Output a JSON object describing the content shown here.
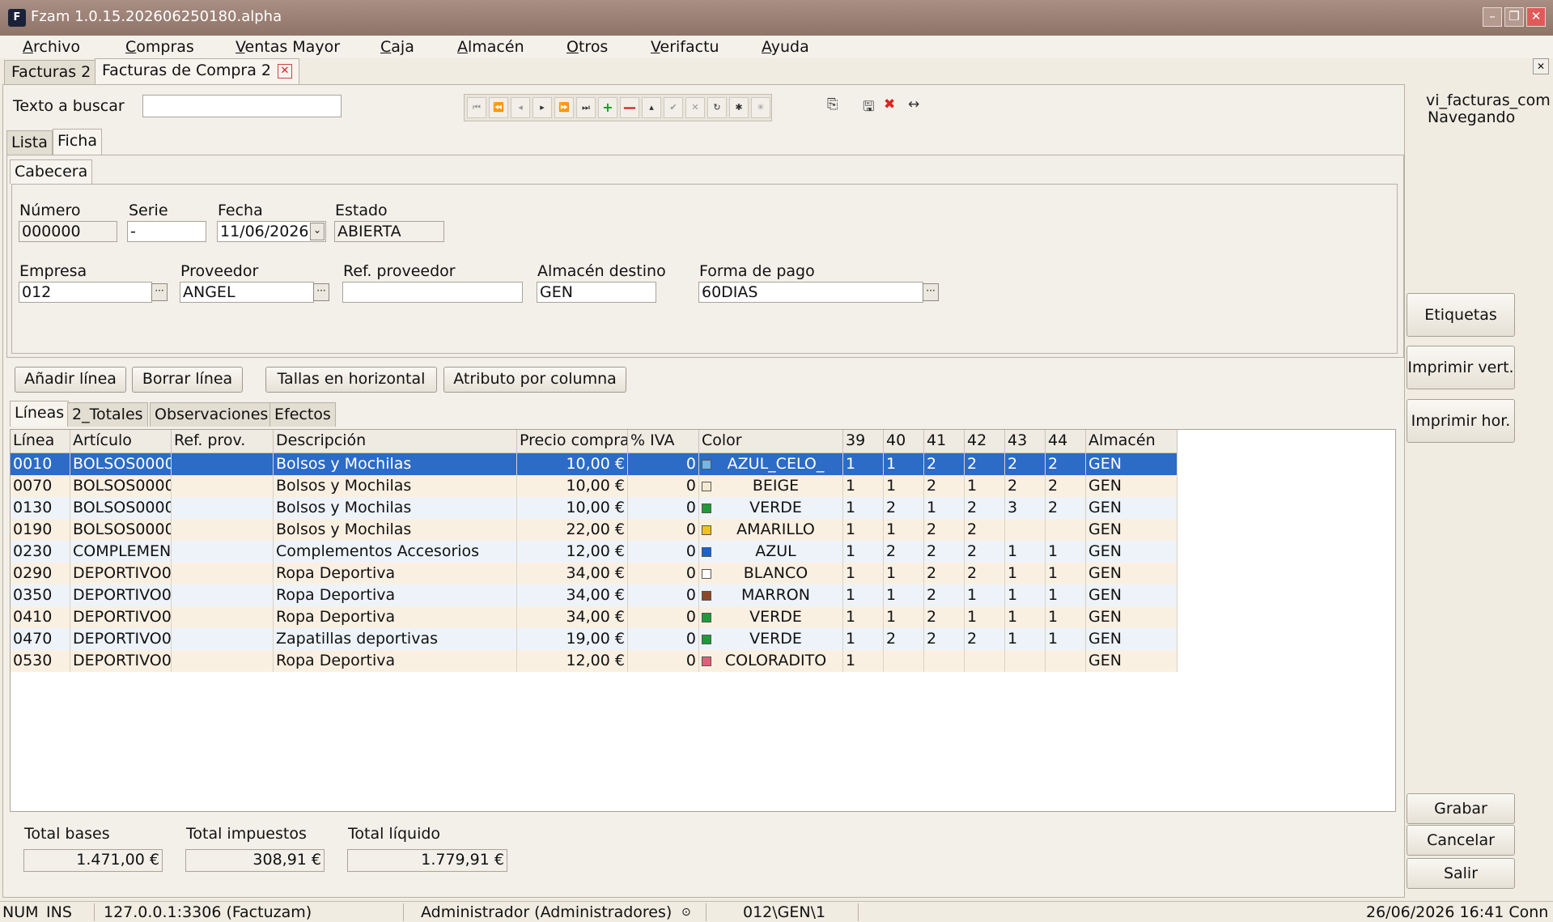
{
  "window": {
    "title": "Fzam 1.0.15.202606250180.alpha",
    "logo": "F"
  },
  "menu": [
    "Archivo",
    "Compras",
    "Ventas Mayor",
    "Caja",
    "Almacén",
    "Otros",
    "Verifactu",
    "Ayuda"
  ],
  "doc_tabs": [
    {
      "label": "Facturas 2"
    },
    {
      "label": "Facturas de Compra 2"
    }
  ],
  "search": {
    "label": "Texto a buscar",
    "value": ""
  },
  "right_info": {
    "view": "vi_facturas_com",
    "mode": "Navegando"
  },
  "view_tabs": [
    "Lista",
    "Ficha"
  ],
  "section_tab": "Cabecera",
  "header": {
    "numero": {
      "label": "Número",
      "value": "000000"
    },
    "serie": {
      "label": "Serie",
      "value": "-"
    },
    "fecha": {
      "label": "Fecha",
      "value": "11/06/2026"
    },
    "estado": {
      "label": "Estado",
      "value": "ABIERTA"
    },
    "empresa": {
      "label": "Empresa",
      "value": "012"
    },
    "proveedor": {
      "label": "Proveedor",
      "value": "ANGEL"
    },
    "ref_proveedor": {
      "label": "Ref. proveedor",
      "value": ""
    },
    "almacen_destino": {
      "label": "Almacén destino",
      "value": "GEN"
    },
    "forma_pago": {
      "label": "Forma de pago",
      "value": "60DIAS"
    }
  },
  "actions": [
    "Añadir línea",
    "Borrar línea",
    "Tallas en horizontal",
    "Atributo por columna"
  ],
  "detail_tabs": [
    "Líneas",
    "2_Totales",
    "Observaciones",
    "Efectos"
  ],
  "columns": [
    "Línea",
    "Artículo",
    "Ref. prov.",
    "Descripción",
    "Precio compra",
    "% IVA",
    "Color",
    "39",
    "40",
    "41",
    "42",
    "43",
    "44",
    "Almacén"
  ],
  "rows": [
    {
      "linea": "0010",
      "articulo": "BOLSOS0000",
      "ref": "",
      "desc": "Bolsos y Mochilas",
      "precio": "10,00 €",
      "iva": "0",
      "color": "AZUL_CELO_",
      "swatch": "#6fb8e8",
      "t39": "1",
      "t40": "1",
      "t41": "2",
      "t42": "2",
      "t43": "2",
      "t44": "2",
      "alm": "GEN"
    },
    {
      "linea": "0070",
      "articulo": "BOLSOS0000",
      "ref": "",
      "desc": "Bolsos y Mochilas",
      "precio": "10,00 €",
      "iva": "0",
      "color": "BEIGE",
      "swatch": "#f3ead0",
      "t39": "1",
      "t40": "1",
      "t41": "2",
      "t42": "1",
      "t43": "2",
      "t44": "2",
      "alm": "GEN"
    },
    {
      "linea": "0130",
      "articulo": "BOLSOS0000",
      "ref": "",
      "desc": "Bolsos y Mochilas",
      "precio": "10,00 €",
      "iva": "0",
      "color": "VERDE",
      "swatch": "#1f9a3a",
      "t39": "1",
      "t40": "2",
      "t41": "1",
      "t42": "2",
      "t43": "3",
      "t44": "2",
      "alm": "GEN"
    },
    {
      "linea": "0190",
      "articulo": "BOLSOS0000",
      "ref": "",
      "desc": "Bolsos y Mochilas",
      "precio": "22,00 €",
      "iva": "0",
      "color": "AMARILLO",
      "swatch": "#f0c21a",
      "t39": "1",
      "t40": "1",
      "t41": "2",
      "t42": "2",
      "t43": "",
      "t44": "",
      "alm": "GEN"
    },
    {
      "linea": "0230",
      "articulo": "COMPLEMEN",
      "ref": "",
      "desc": "Complementos Accesorios",
      "precio": "12,00 €",
      "iva": "0",
      "color": "AZUL",
      "swatch": "#1f5fd0",
      "t39": "1",
      "t40": "2",
      "t41": "2",
      "t42": "2",
      "t43": "1",
      "t44": "1",
      "alm": "GEN"
    },
    {
      "linea": "0290",
      "articulo": "DEPORTIVO0",
      "ref": "",
      "desc": "Ropa Deportiva",
      "precio": "34,00 €",
      "iva": "0",
      "color": "BLANCO",
      "swatch": "#ffffff",
      "t39": "1",
      "t40": "1",
      "t41": "2",
      "t42": "2",
      "t43": "1",
      "t44": "1",
      "alm": "GEN"
    },
    {
      "linea": "0350",
      "articulo": "DEPORTIVO0",
      "ref": "",
      "desc": "Ropa Deportiva",
      "precio": "34,00 €",
      "iva": "0",
      "color": "MARRON",
      "swatch": "#8a4a2a",
      "t39": "1",
      "t40": "1",
      "t41": "2",
      "t42": "1",
      "t43": "1",
      "t44": "1",
      "alm": "GEN"
    },
    {
      "linea": "0410",
      "articulo": "DEPORTIVO0",
      "ref": "",
      "desc": "Ropa Deportiva",
      "precio": "34,00 €",
      "iva": "0",
      "color": "VERDE",
      "swatch": "#1f9a3a",
      "t39": "1",
      "t40": "1",
      "t41": "2",
      "t42": "1",
      "t43": "1",
      "t44": "1",
      "alm": "GEN"
    },
    {
      "linea": "0470",
      "articulo": "DEPORTIVO0",
      "ref": "",
      "desc": "Zapatillas deportivas",
      "precio": "19,00 €",
      "iva": "0",
      "color": "VERDE",
      "swatch": "#1f9a3a",
      "t39": "1",
      "t40": "2",
      "t41": "2",
      "t42": "2",
      "t43": "1",
      "t44": "1",
      "alm": "GEN"
    },
    {
      "linea": "0530",
      "articulo": "DEPORTIVO0",
      "ref": "",
      "desc": "Ropa Deportiva",
      "precio": "12,00 €",
      "iva": "0",
      "color": "COLORADITO",
      "swatch": "#e0607a",
      "t39": "1",
      "t40": "",
      "t41": "",
      "t42": "",
      "t43": "",
      "t44": "",
      "alm": "GEN"
    }
  ],
  "totals": {
    "bases": {
      "label": "Total bases",
      "value": "1.471,00 €"
    },
    "impuestos": {
      "label": "Total impuestos",
      "value": "308,91 €"
    },
    "liquido": {
      "label": "Total líquido",
      "value": "1.779,91 €"
    }
  },
  "side_buttons": [
    "Etiquetas",
    "Imprimir vert.",
    "Imprimir hor."
  ],
  "bottom_buttons": [
    "Grabar",
    "Cancelar",
    "Salir"
  ],
  "status": {
    "num": "NUM",
    "ins": "INS",
    "server": "127.0.0.1:3306 (Factuzam)",
    "user": "Administrador (Administradores)",
    "path": "012\\GEN\\1",
    "datetime": "26/06/2026 16:41 Conn"
  },
  "colors": {
    "selection": "#2c6bc6",
    "title_bar": "#9a7f74",
    "row_alt_1": "#eef3f9",
    "row_alt_2": "#faf0e2"
  }
}
